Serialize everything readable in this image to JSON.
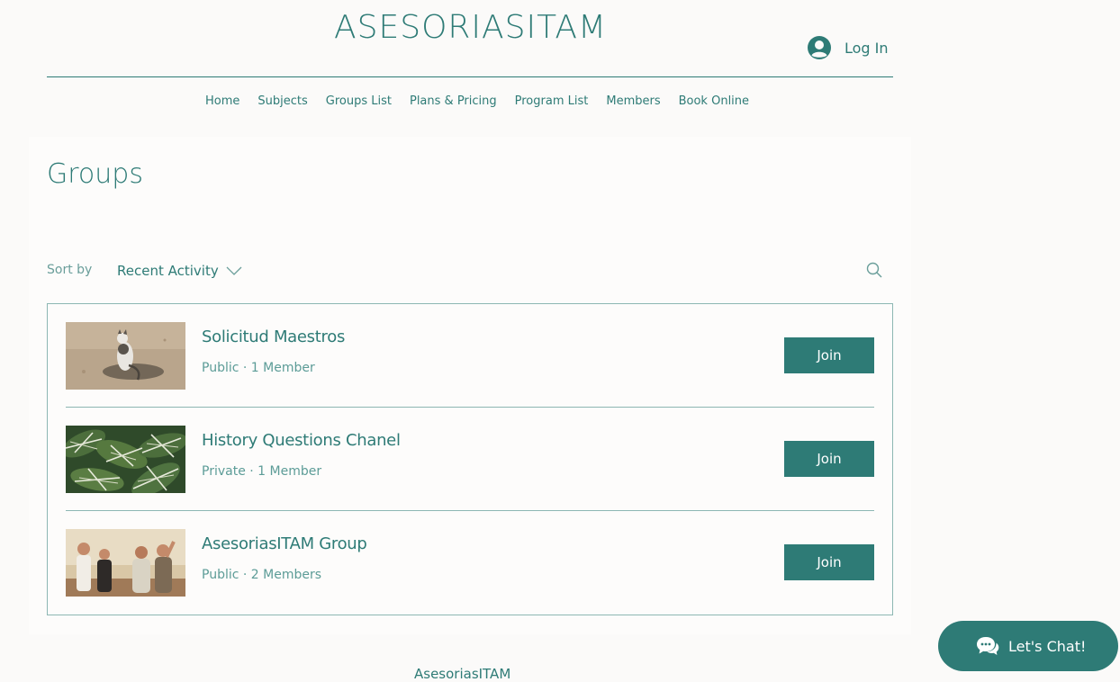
{
  "header": {
    "site_title": "ASESORIASITAM",
    "login_label": "Log In",
    "avatar_icon": "user-circle-icon"
  },
  "nav": {
    "items": [
      {
        "label": "Home"
      },
      {
        "label": "Subjects"
      },
      {
        "label": "Groups List"
      },
      {
        "label": "Plans & Pricing"
      },
      {
        "label": "Program List"
      },
      {
        "label": "Members"
      },
      {
        "label": "Book Online"
      }
    ]
  },
  "page": {
    "title": "Groups"
  },
  "sort": {
    "label": "Sort by",
    "value": "Recent Activity",
    "chevron_icon": "chevron-down-icon",
    "search_icon": "search-icon"
  },
  "groups": [
    {
      "name": "Solicitud Maestros",
      "meta": "Public · 1 Member",
      "join_label": "Join",
      "thumbnail": "cat-on-sand-image"
    },
    {
      "name": "History Questions Chanel",
      "meta": "Private · 1 Member",
      "join_label": "Join",
      "thumbnail": "striped-leaves-image"
    },
    {
      "name": "AsesoriasITAM Group",
      "meta": "Public · 2 Members",
      "join_label": "Join",
      "thumbnail": "friends-group-image"
    }
  ],
  "footer": {
    "text": "AsesoriasITAM"
  },
  "chat": {
    "label": "Let's Chat!",
    "icon": "chat-bubbles-icon"
  },
  "colors": {
    "accent": "#2e7b76",
    "background": "#fbfaf9",
    "border": "#8db7b3",
    "meta_text": "#5c9c97"
  }
}
